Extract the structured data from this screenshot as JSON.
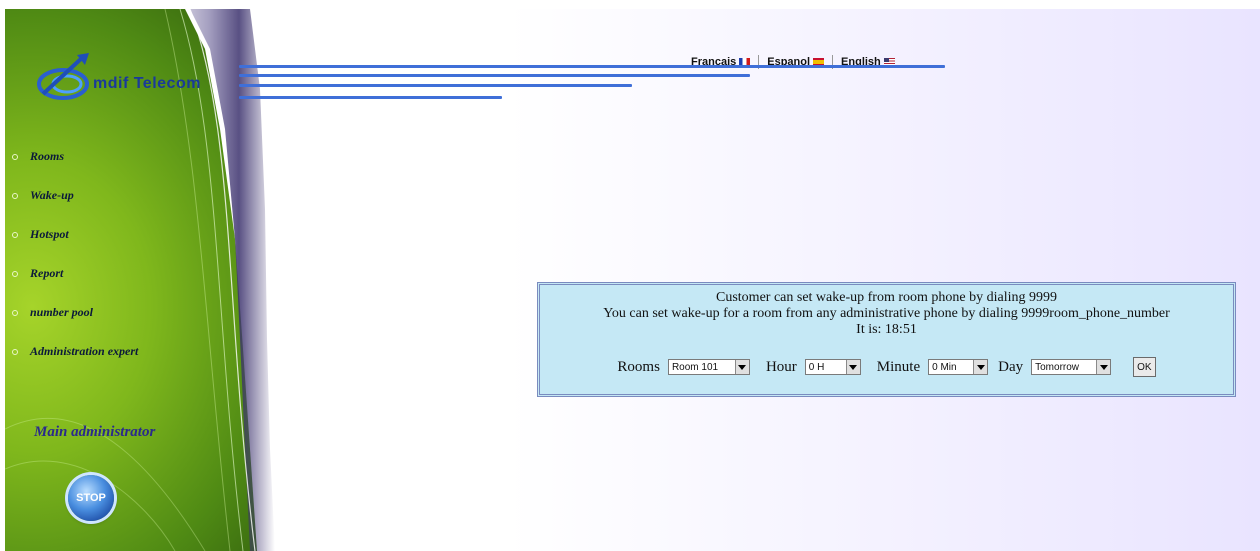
{
  "brand": {
    "logo_text": "mdif Telecom",
    "logo_color": "#1a3a9a"
  },
  "sidebar": {
    "items": [
      {
        "label": "Rooms"
      },
      {
        "label": "Wake-up"
      },
      {
        "label": "Hotspot"
      },
      {
        "label": "Report"
      },
      {
        "label": "number pool"
      },
      {
        "label": "Administration expert"
      }
    ],
    "user_role": "Main administrator",
    "stop_label": "STOP"
  },
  "languages": [
    {
      "label": "Francais",
      "flag": "fr-flag-icon"
    },
    {
      "label": "Espanol",
      "flag": "es-flag-icon"
    },
    {
      "label": "English",
      "flag": "us-flag-icon"
    }
  ],
  "wakeup": {
    "info_line1": "Customer can set wake-up from room phone by dialing 9999",
    "info_line2": "You can set wake-up for a room from any administrative phone by dialing 9999room_phone_number",
    "info_line3": "It is: 18:51",
    "form": {
      "rooms_label": "Rooms",
      "rooms_value": "Room 101",
      "hour_label": "Hour",
      "hour_value": "0 H",
      "minute_label": "Minute",
      "minute_value": "0 Min",
      "day_label": "Day",
      "day_value": "Tomorrow",
      "ok_label": "OK"
    }
  },
  "colors": {
    "accent": "#3f6fd8",
    "panel_bg": "#c5e8f5",
    "sidebar_green": "#7fb71c"
  }
}
